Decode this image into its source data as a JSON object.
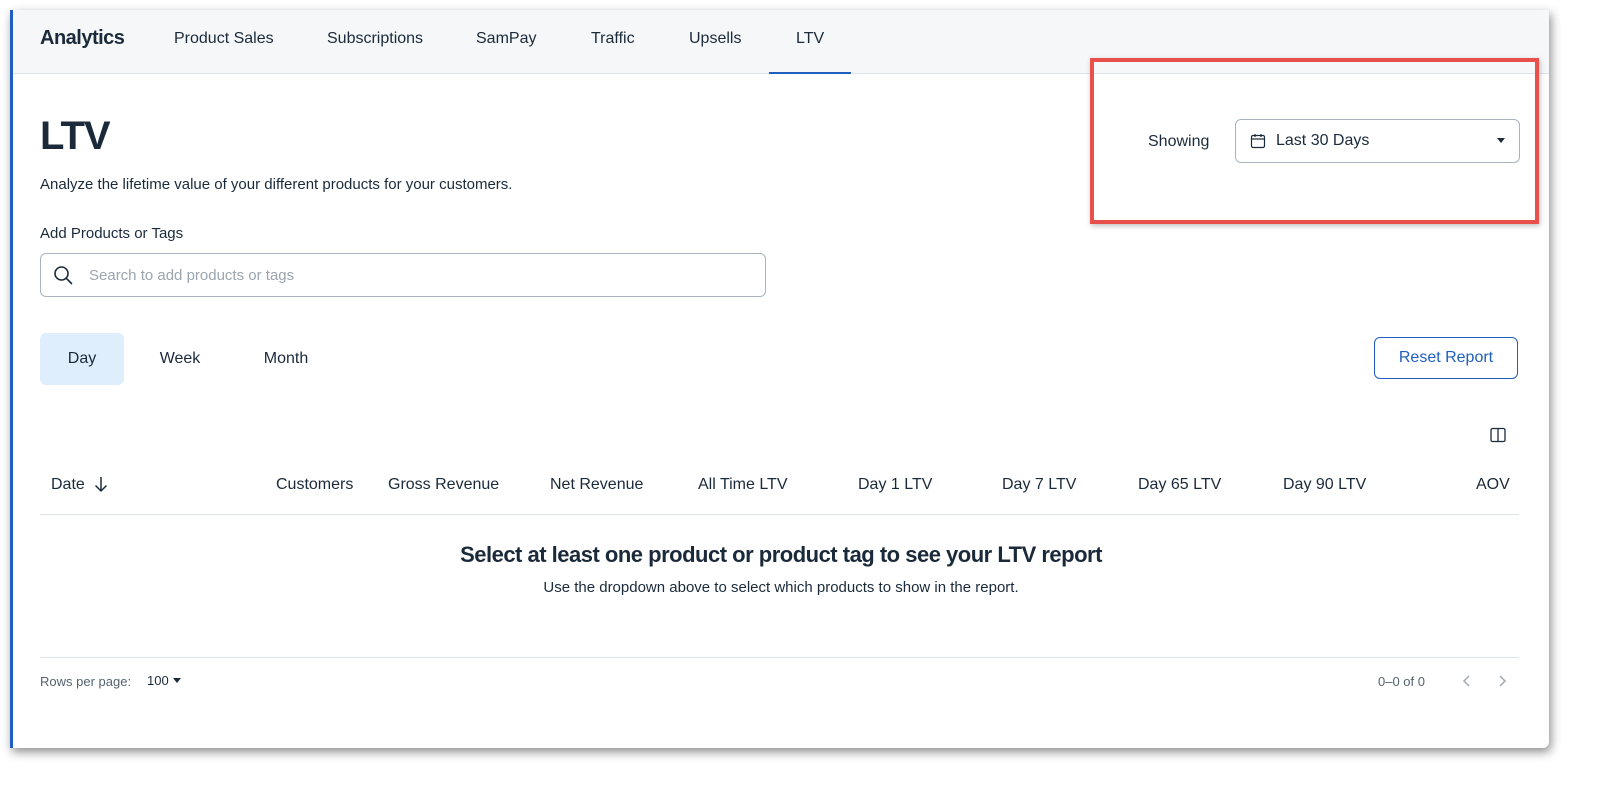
{
  "nav": {
    "brand": "Analytics",
    "tabs": [
      {
        "label": "Product Sales"
      },
      {
        "label": "Subscriptions"
      },
      {
        "label": "SamPay"
      },
      {
        "label": "Traffic"
      },
      {
        "label": "Upsells"
      },
      {
        "label": "LTV",
        "active": true
      }
    ]
  },
  "page": {
    "title": "LTV",
    "description": "Analyze the lifetime value of your different products for your customers."
  },
  "search": {
    "label": "Add Products or Tags",
    "placeholder": "Search to add products or tags",
    "value": ""
  },
  "date_filter": {
    "label": "Showing",
    "value": "Last 30 Days"
  },
  "periods": [
    {
      "label": "Day",
      "active": true
    },
    {
      "label": "Week"
    },
    {
      "label": "Month"
    }
  ],
  "reset_label": "Reset Report",
  "table": {
    "columns": [
      "Date",
      "Customers",
      "Gross Revenue",
      "Net Revenue",
      "All Time LTV",
      "Day 1 LTV",
      "Day 7 LTV",
      "Day 65 LTV",
      "Day 90 LTV",
      "AOV"
    ]
  },
  "empty_state": {
    "title": "Select at least one product or product tag to see your LTV report",
    "description": "Use the dropdown above to select which products to show in the report."
  },
  "pagination": {
    "rows_label": "Rows per page:",
    "rows_value": "100",
    "range": "0–0 of 0"
  },
  "colors": {
    "accent": "#1f5fbf",
    "highlight": "#e8514b",
    "active_period_bg": "#dfeefc",
    "text": "#1b2a3a"
  }
}
